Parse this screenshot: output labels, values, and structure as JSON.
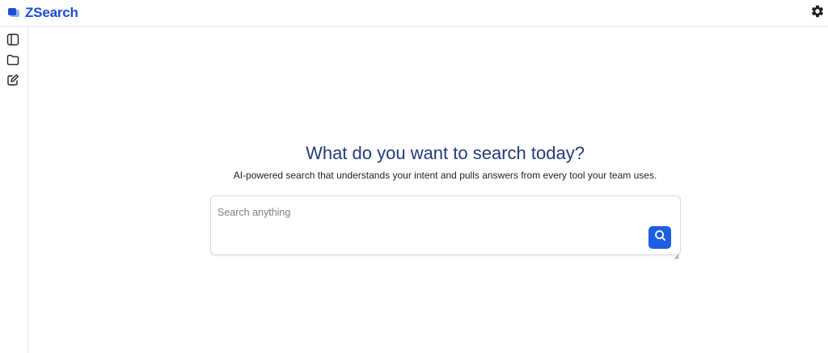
{
  "header": {
    "app_name": "ZSearch",
    "logo_icon": "chat-bubbles-icon",
    "settings_icon": "gear-icon",
    "brand_color": "#1d4ed8"
  },
  "sidebar": {
    "items": [
      {
        "icon": "sidebar-toggle-icon"
      },
      {
        "icon": "folder-icon"
      },
      {
        "icon": "edit-icon"
      }
    ]
  },
  "main": {
    "title": "What do you want to search today?",
    "subtitle": "AI-powered search that understands your intent and pulls answers from every tool your team uses.",
    "title_color": "#233a7a"
  },
  "search": {
    "value": "",
    "placeholder": "Search anything",
    "button_icon": "search-icon",
    "button_color": "#1d5fe0"
  }
}
